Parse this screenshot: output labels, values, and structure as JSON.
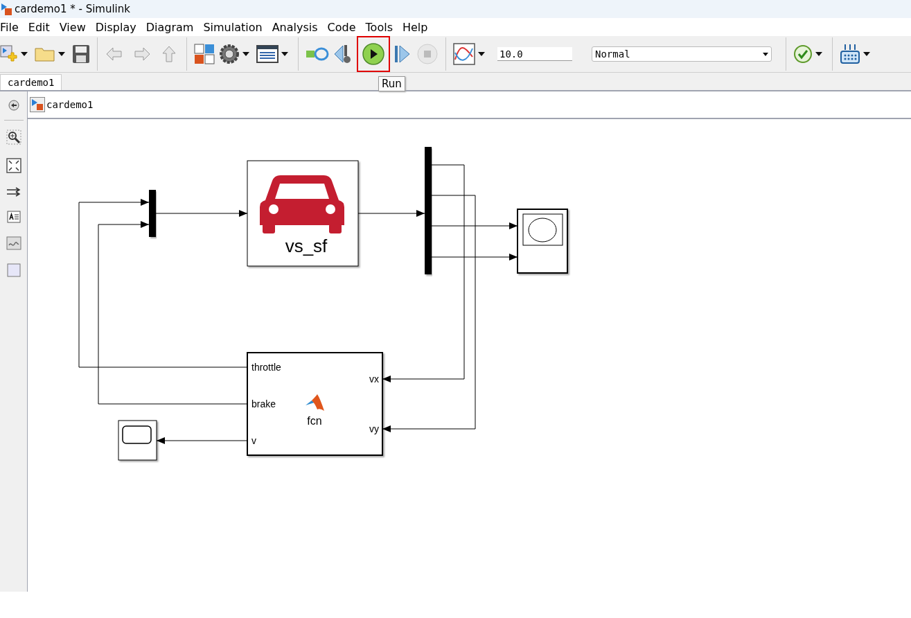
{
  "window": {
    "title": "cardemo1 * - Simulink"
  },
  "menu": [
    "File",
    "Edit",
    "View",
    "Display",
    "Diagram",
    "Simulation",
    "Analysis",
    "Code",
    "Tools",
    "Help"
  ],
  "toolbar": {
    "navigation": [
      {
        "disabled": true
      },
      {
        "disabled": true
      },
      {
        "disabled": true
      }
    ],
    "run_highlighted": true,
    "stop_time": "10.0",
    "mode": "Normal"
  },
  "tooltip": "Run",
  "tabs": [
    {
      "label": "cardemo1",
      "selected": true
    }
  ],
  "breadcrumb": "cardemo1",
  "diagram": {
    "vehicle_block": {
      "label": "vs_sf"
    },
    "function_block": {
      "name": "fcn",
      "left_ports": [
        "throttle",
        "brake",
        "v"
      ],
      "right_ports": [
        "vx",
        "vy"
      ]
    }
  }
}
